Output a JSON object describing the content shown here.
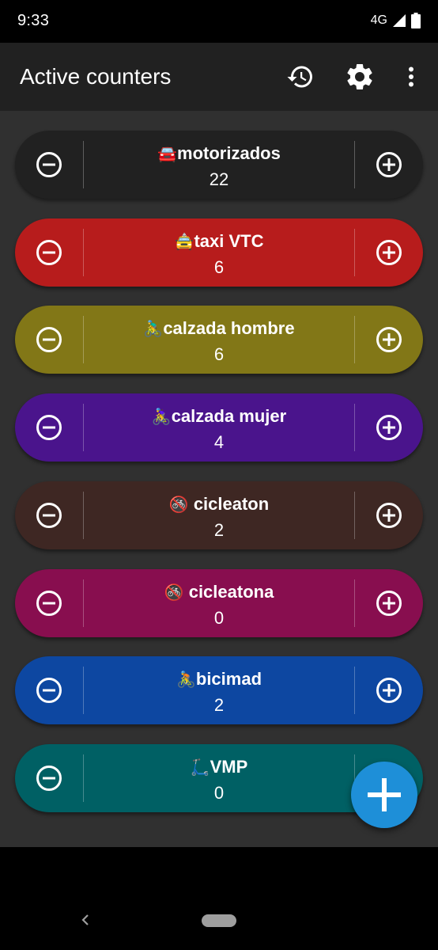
{
  "status": {
    "time": "9:33",
    "network": "4G"
  },
  "appbar": {
    "title": "Active counters",
    "icons": [
      "restore-icon",
      "gear-icon",
      "more-vertical-icon"
    ]
  },
  "counters": [
    {
      "emoji": "🚘",
      "label": "motorizados",
      "count": "22",
      "color": "#212121"
    },
    {
      "emoji": "🚖",
      "label": "taxi VTC",
      "count": "6",
      "color": "#b71c1c"
    },
    {
      "emoji": "🚴‍♂️",
      "label": "calzada hombre",
      "count": "6",
      "color": "#827717"
    },
    {
      "emoji": "🚴‍♀️",
      "label": "calzada mujer",
      "count": "4",
      "color": "#4a148c"
    },
    {
      "emoji": "🚳",
      "label": " cicleaton",
      "count": "2",
      "color": "#3e2723"
    },
    {
      "emoji": "🚳",
      "label": " cicleatona",
      "count": "0",
      "color": "#880e4f"
    },
    {
      "emoji": "🚴",
      "label": "bicimad",
      "count": "2",
      "color": "#0d47a1"
    },
    {
      "emoji": "🛴",
      "label": "VMP",
      "count": "0",
      "color": "#006064"
    }
  ],
  "fab": {
    "icon": "add-icon",
    "color": "#1e8fd8"
  }
}
